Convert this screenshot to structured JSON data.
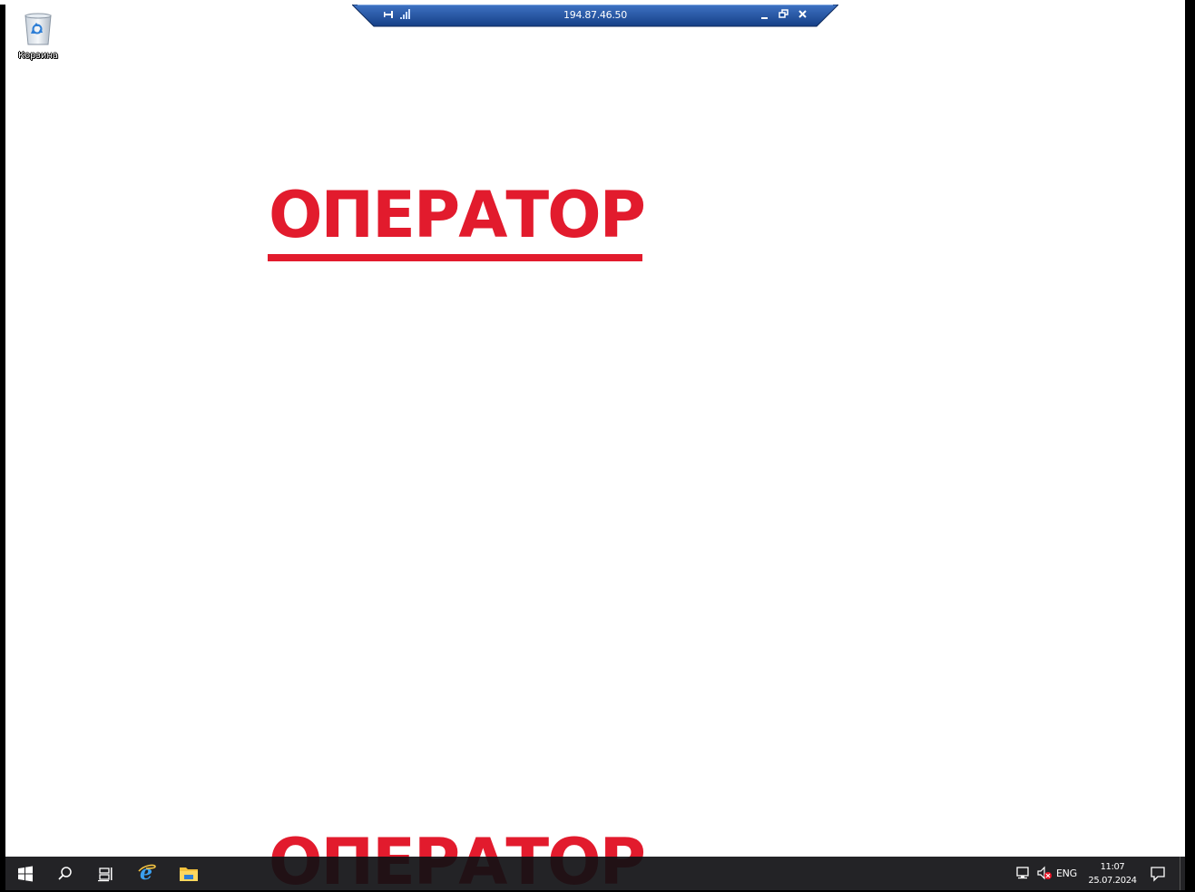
{
  "desktop": {
    "icons": [
      {
        "label": "Корзина",
        "icon": "recycle-bin-icon"
      }
    ],
    "wallpaper_text": "ОПЕРАТОР",
    "wallpaper_color": "#e21b2d"
  },
  "rdp_bar": {
    "title": "194.87.46.50",
    "icons": [
      "pin-icon",
      "signal-icon",
      "minimize-icon",
      "restore-icon",
      "close-icon"
    ],
    "color": "#1b4fa0"
  },
  "taskbar": {
    "buttons": [
      "windows-start-icon",
      "search-icon",
      "task-view-icon",
      "internet-explorer-icon",
      "file-explorer-icon"
    ],
    "tray": {
      "language": "ENG",
      "time": "11:07",
      "date": "25.07.2024",
      "icons": [
        "network-icon",
        "volume-muted-icon",
        "notification-icon"
      ]
    }
  }
}
